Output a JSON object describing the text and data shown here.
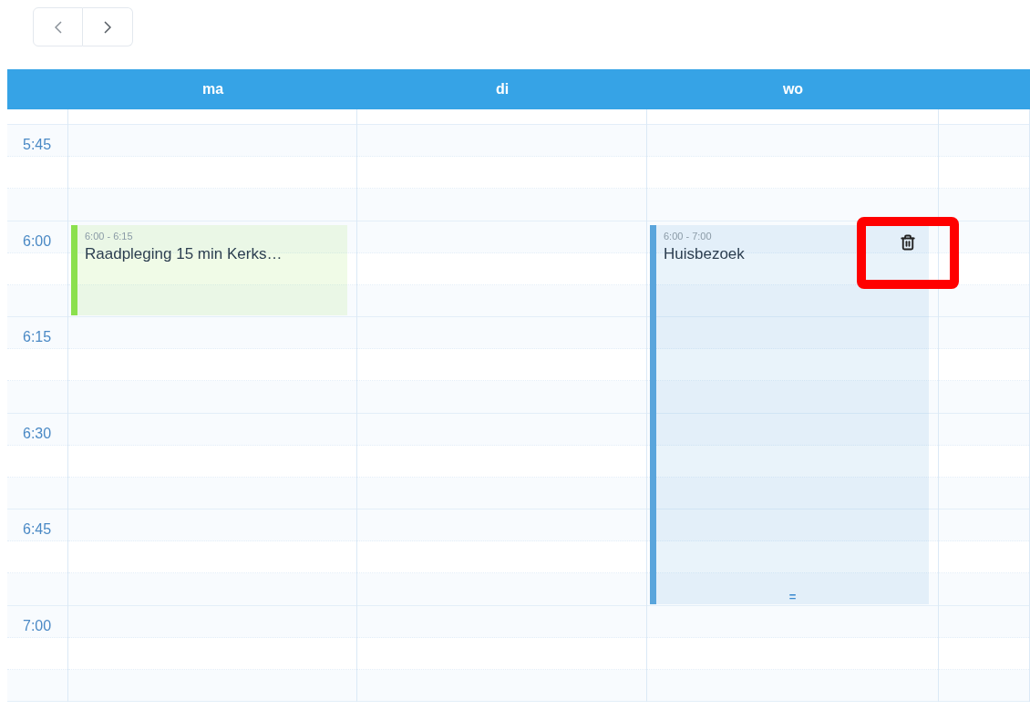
{
  "days": [
    {
      "label": "ma",
      "events": [
        {
          "time": "6:00 - 6:15",
          "title": "Raadpleging 15 min Kerks…",
          "color": "#8be04e"
        }
      ]
    },
    {
      "label": "di"
    },
    {
      "label": "wo",
      "events": [
        {
          "time": "6:00 - 7:00",
          "title": "Huisbezoek",
          "color": "#5aa5dc",
          "handle": "=",
          "delete_highlighted": true
        }
      ]
    }
  ],
  "times": [
    "5:45",
    "6:00",
    "6:15",
    "6:30",
    "6:45",
    "7:00"
  ]
}
